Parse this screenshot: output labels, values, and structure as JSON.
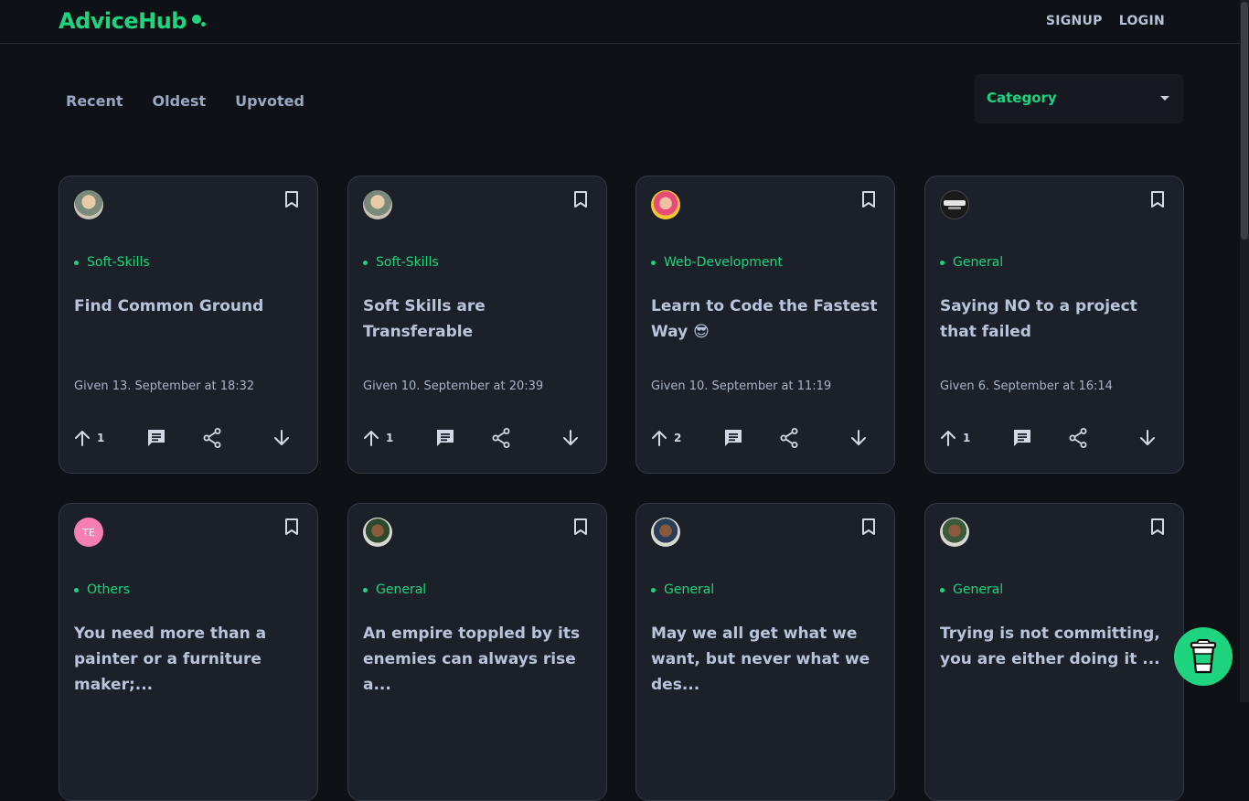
{
  "header": {
    "logo": "AdviceHub",
    "signup": "SIGNUP",
    "login": "LOGIN"
  },
  "tabs": [
    "Recent",
    "Oldest",
    "Upvoted"
  ],
  "category_select": {
    "label": "Category"
  },
  "colors": {
    "accent": "#1ed47f",
    "card_bg": "#1c2028",
    "page_bg": "#0e1116"
  },
  "cards": [
    {
      "category": "Soft-Skills",
      "title": "Find Common Ground",
      "date": "Given 13. September at 18:32",
      "upvotes": "1",
      "avatar": "photo"
    },
    {
      "category": "Soft-Skills",
      "title": "Soft Skills are Transferable",
      "date": "Given 10. September at 20:39",
      "upvotes": "1",
      "avatar": "photo"
    },
    {
      "category": "Web-Development",
      "title": "Learn to Code the Fastest Way 😎",
      "date": "Given 10. September at 11:19",
      "upvotes": "2",
      "avatar": "photo-colorful"
    },
    {
      "category": "General",
      "title": "Saying NO to a project that failed",
      "date": "Given 6. September at 16:14",
      "upvotes": "1",
      "avatar": "booba-games-logo"
    },
    {
      "category": "Others",
      "title": "You need more than a painter or a furniture maker;...",
      "date": "",
      "upvotes": "",
      "avatar": "TE"
    },
    {
      "category": "General",
      "title": "An empire toppled by its enemies can always rise a...",
      "date": "",
      "upvotes": "",
      "avatar": "photo"
    },
    {
      "category": "General",
      "title": "May we all get what we want, but never what we des...",
      "date": "",
      "upvotes": "",
      "avatar": "photo"
    },
    {
      "category": "General",
      "title": "Trying is not committing, you are either doing it ...",
      "date": "",
      "upvotes": "",
      "avatar": "photo"
    }
  ],
  "floating_button": {
    "icon": "coffee-cup-icon"
  }
}
